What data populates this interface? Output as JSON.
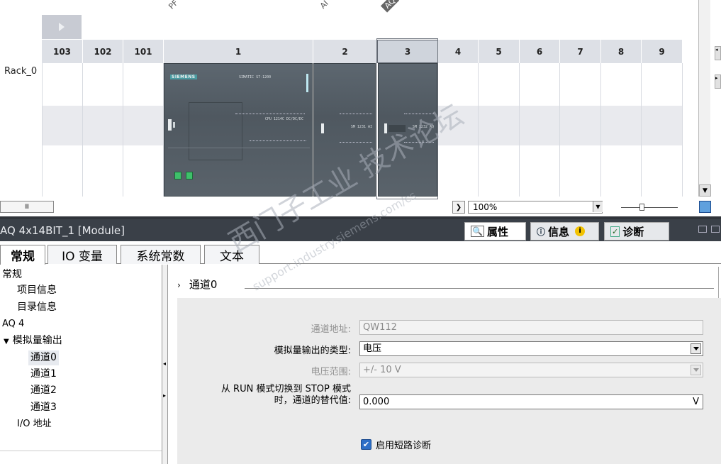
{
  "device": {
    "rotated_labels": [
      "PF",
      "AI",
      "AQ"
    ],
    "slots": [
      "103",
      "102",
      "101",
      "1",
      "2",
      "3",
      "4",
      "5",
      "6",
      "7",
      "8",
      "9"
    ],
    "rack_label": "Rack_0",
    "zoom": "100%",
    "cpu_brand": "SIEMENS",
    "cpu_model": "SIMATIC S7-1200",
    "cpu_type": "CPU 1214C DC/DC/DC",
    "sm_ai": "SM 1231 AI",
    "sm_aq": "SM 1232 AQ"
  },
  "inspector": {
    "title": "AQ 4x14BIT_1 [Module]",
    "top_tabs": {
      "properties": "属性",
      "info": "信息",
      "diagnostics": "诊断"
    },
    "tabs": [
      "常规",
      "IO 变量",
      "系统常数",
      "文本"
    ]
  },
  "tree": {
    "items": [
      "常规",
      "项目信息",
      "目录信息",
      "AQ 4",
      "模拟量输出",
      "通道0",
      "通道1",
      "通道2",
      "通道3",
      "I/O 地址"
    ]
  },
  "section": {
    "title": "通道0"
  },
  "form": {
    "address_label": "通道地址:",
    "address_value": "QW112",
    "type_label": "模拟量输出的类型:",
    "type_value": "电压",
    "range_label": "电压范围:",
    "range_value": "+/- 10 V",
    "subst_label_1": "从 RUN 模式切换到 STOP 模式",
    "subst_label_2": "时，通道的替代值:",
    "subst_value": "0.000",
    "subst_unit": "V",
    "shortcircuit_label": "启用短路诊断"
  },
  "watermark": {
    "line1": "西门子工业 技术论坛",
    "line2": "support.industry.siemens.com/cs"
  },
  "colors": {
    "header_dark": "#3a4048",
    "panel_bg": "#ebebeb",
    "checkbox": "#2d6fc7",
    "port_green": "#3ec06a"
  }
}
